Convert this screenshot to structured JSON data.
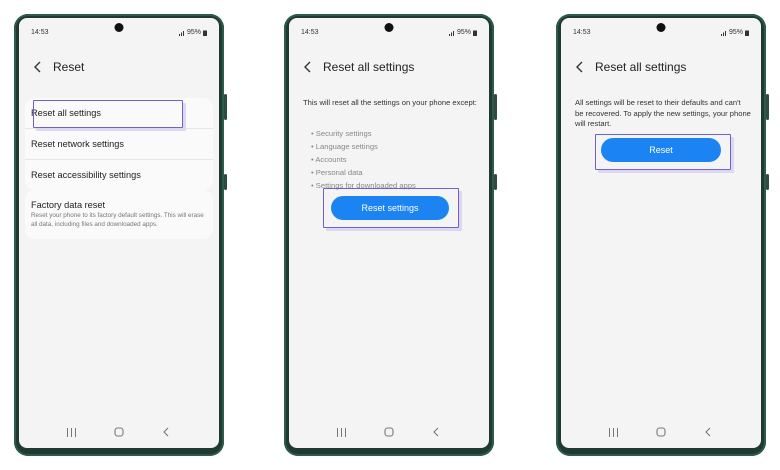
{
  "status_bar": {
    "time": "14:53",
    "battery": "95%"
  },
  "screens": [
    {
      "title": "Reset",
      "items": [
        "Reset all settings",
        "Reset network settings",
        "Reset accessibility settings"
      ],
      "factory_reset": {
        "title": "Factory data reset",
        "description": "Reset your phone to its factory default settings. This will erase all data, including files and downloaded apps."
      }
    },
    {
      "title": "Reset all settings",
      "intro": "This will reset all the settings on your phone except:",
      "bullets": [
        "Security settings",
        "Language settings",
        "Accounts",
        "Personal data",
        "Settings for downloaded apps"
      ],
      "button": "Reset settings"
    },
    {
      "title": "Reset all settings",
      "intro": "All settings will be reset to their defaults and can't be recovered. To apply the new settings, your phone will restart.",
      "button": "Reset"
    }
  ],
  "colors": {
    "accent": "#1b84f2",
    "highlight_border": "#6f63c9",
    "phone_frame": "#1f3a33"
  },
  "nav_icons": [
    "recent-apps-icon",
    "home-icon",
    "back-icon"
  ]
}
